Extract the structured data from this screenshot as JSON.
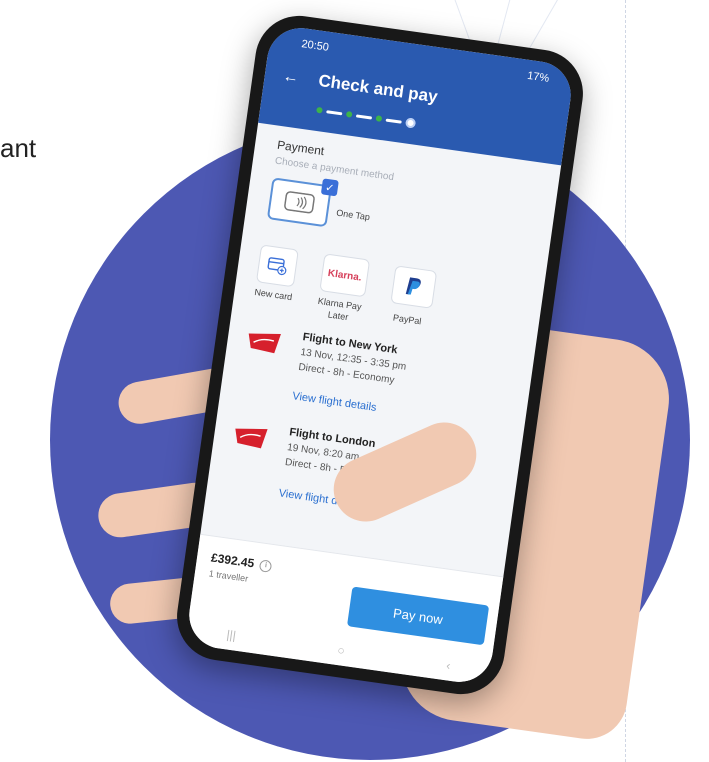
{
  "page_fragment": "ant",
  "phone": {
    "status": {
      "time": "20:50",
      "battery": "17%"
    },
    "header": {
      "title": "Check and pay"
    },
    "payment": {
      "title": "Payment",
      "subtitle": "Choose a payment method",
      "methods": [
        {
          "label": "One Tap",
          "selected": true
        },
        {
          "label": "New card"
        },
        {
          "label": "Klarna Pay Later",
          "logo_text": "Klarna."
        },
        {
          "label": "PayPal"
        }
      ]
    },
    "flights": [
      {
        "title": "Flight to New York",
        "date": "13 Nov, 12:35 - 3:35 pm",
        "details": "Direct - 8h - Economy",
        "link": "View flight details"
      },
      {
        "title": "Flight to London",
        "date": "19 Nov, 8:20 am",
        "details": "Direct - 8h - Econo",
        "link": "View flight details"
      }
    ],
    "footer": {
      "price": "£392.45",
      "travellers": "1 traveller",
      "pay_button": "Pay now"
    }
  },
  "colors": {
    "brand_blue": "#2a5ab0",
    "circle": "#4d58b3",
    "pay_button": "#2f8fe0",
    "link": "#2a6fd0",
    "virgin_red": "#d6202c"
  }
}
